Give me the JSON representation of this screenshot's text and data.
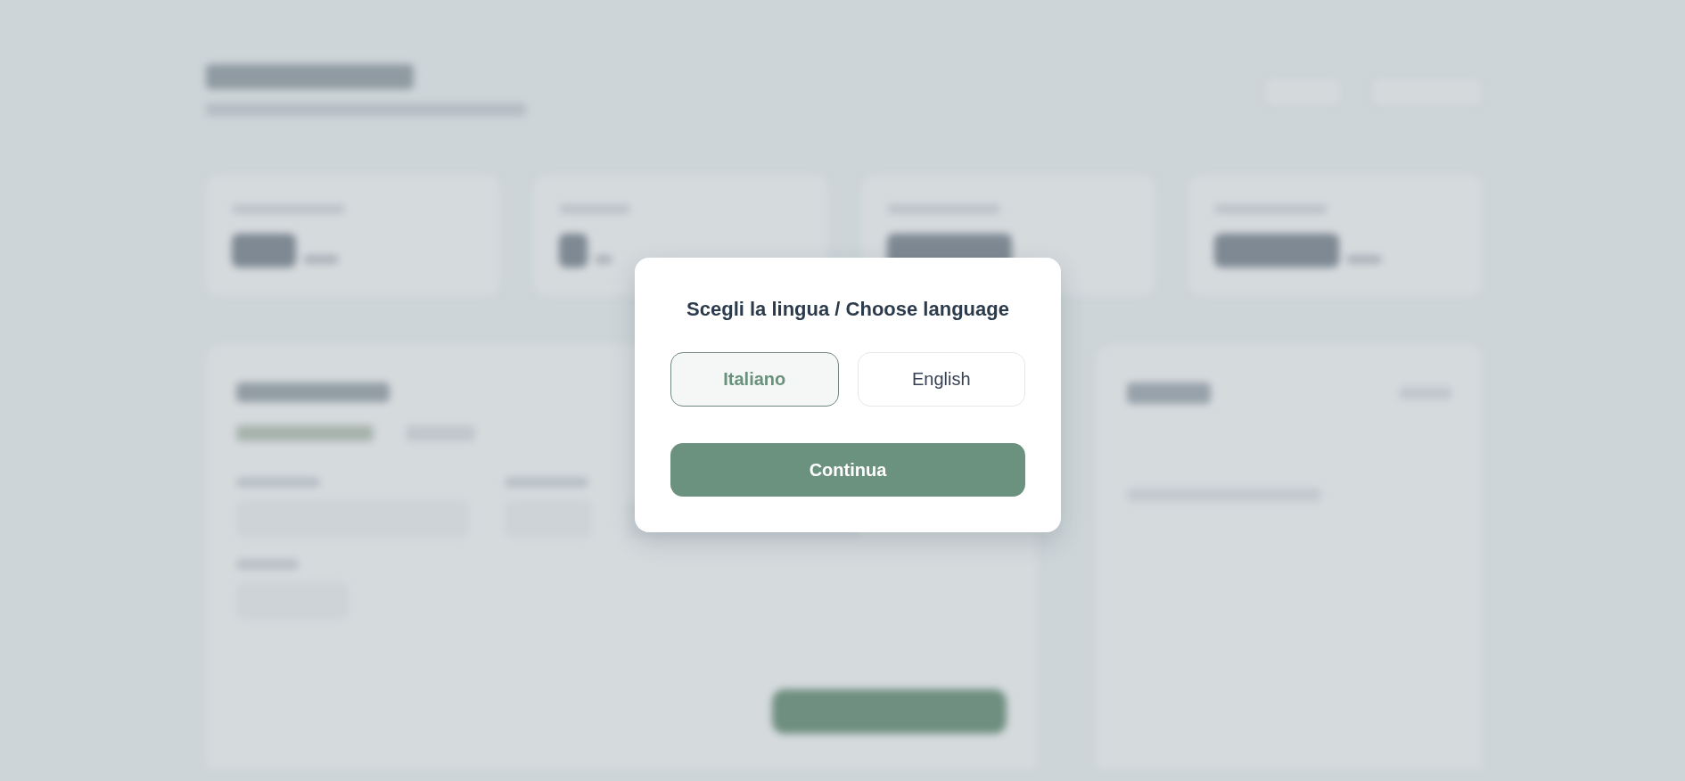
{
  "dialog": {
    "title": "Scegli la lingua / Choose language",
    "options": [
      {
        "label": "Italiano",
        "selected": true
      },
      {
        "label": "English",
        "selected": false
      }
    ],
    "button": {
      "label": "Continua"
    }
  }
}
